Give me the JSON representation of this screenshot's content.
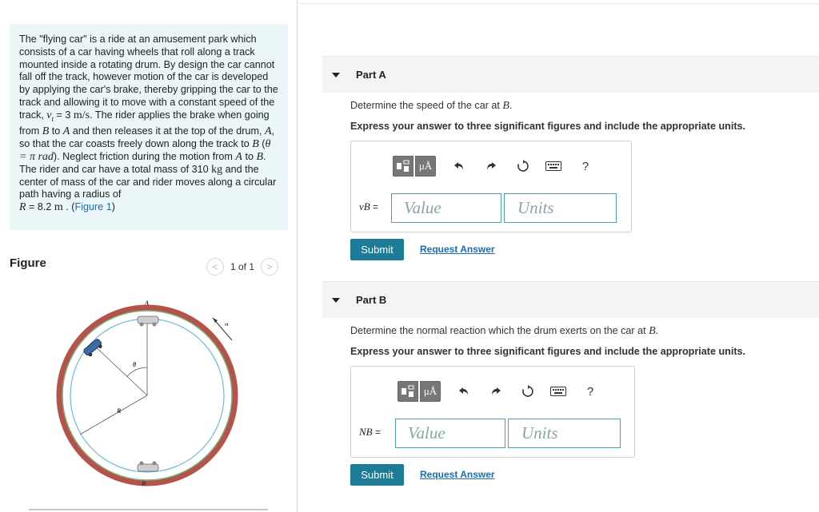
{
  "problem": {
    "t1": "The \"flying car\" is a ride at an amusement park which consists of a car having wheels that roll along a track mounted inside a rotating drum. By design the car cannot fall off the track, however motion of the car is developed by applying the car's brake, thereby gripping the car to the track and allowing it to move with a constant speed of the track, ",
    "vt_sym": "v",
    "vt_sub": "t",
    "vt_val": " = 3 ",
    "vt_unit": "m/s",
    "t2": ". The rider applies the brake when going from ",
    "B1": "B",
    "t3": " to ",
    "A1": "A",
    "t4": " and then releases it at the top of the drum, ",
    "A2": "A",
    "t5": ", so that the car coasts freely down along the track to ",
    "B2": "B",
    "t6": " (",
    "theta": "θ = π rad",
    "t7": "). Neglect friction during the motion from ",
    "A3": "A",
    "t8": " to ",
    "B3": "B",
    "t9": ". The rider and car have a total mass of 310 ",
    "kg": "kg",
    "t10": " and the center of mass of the car and rider moves along a circular path having a radius of",
    "R_sym": "R",
    "R_val": " = 8.2 ",
    "R_unit": "m",
    "t11": " . (",
    "fig_link": "Figure 1",
    "t12": ")"
  },
  "figure": {
    "label": "Figure",
    "pager_text": "1 of 1",
    "prev": "<",
    "next": ">",
    "labels": {
      "A": "A",
      "B": "B",
      "R": "R",
      "theta": "θ",
      "vt": "vt"
    }
  },
  "partA": {
    "title": "Part A",
    "question_pre": "Determine the speed of the car at ",
    "question_var": "B",
    "question_post": ".",
    "instruction": "Express your answer to three significant figures and include the appropriate units.",
    "var_sym": "vB",
    "eq": " = ",
    "value_placeholder": "Value",
    "units_placeholder": "Units",
    "submit": "Submit",
    "request": "Request Answer"
  },
  "partB": {
    "title": "Part B",
    "question_pre": "Determine the normal reaction which the drum exerts on the car at ",
    "question_var": "B",
    "question_post": ".",
    "instruction": "Express your answer to three significant figures and include the appropriate units.",
    "var_sym": "NB",
    "eq": " = ",
    "value_placeholder": "Value",
    "units_placeholder": "Units",
    "submit": "Submit",
    "request": "Request Answer"
  },
  "toolbar": {
    "mu": "μÅ",
    "help": "?"
  }
}
